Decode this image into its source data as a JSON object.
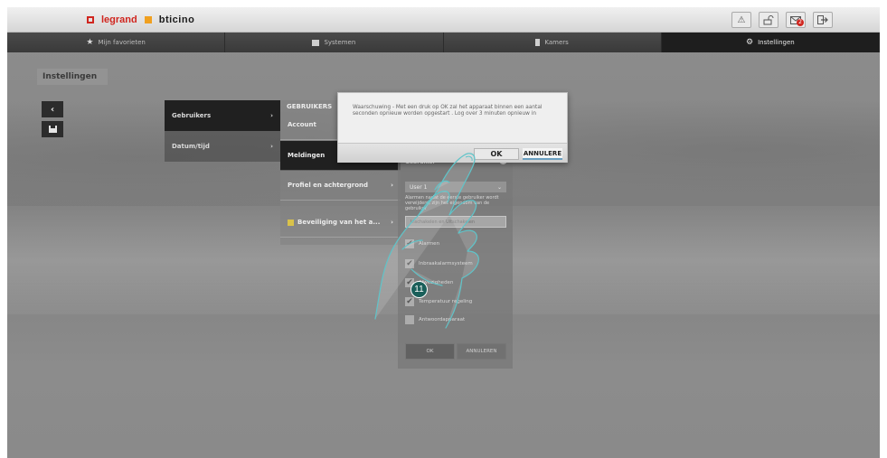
{
  "brand": {
    "legrand": "legrand",
    "bticino": "bticino"
  },
  "topbar": {
    "msg_count": "2"
  },
  "nav": {
    "tabs": [
      {
        "label": "Mijn favorieten"
      },
      {
        "label": "Systemen"
      },
      {
        "label": "Kamers"
      },
      {
        "label": "Instellingen"
      }
    ]
  },
  "page": {
    "title": "Instellingen",
    "back": "‹"
  },
  "menu": {
    "items": [
      {
        "label": "Gebruikers",
        "chev": "›"
      },
      {
        "label": "Datum/tijd",
        "chev": "›"
      }
    ]
  },
  "submenu": {
    "header": "GEBRUIKERS",
    "items": [
      {
        "label": "Account",
        "chev": ""
      },
      {
        "label": "Meldingen",
        "chev": ""
      },
      {
        "label": "Profiel en achtergrond",
        "chev": "›"
      },
      {
        "label": "Beveiliging van het a...",
        "chev": "›"
      }
    ]
  },
  "form": {
    "label": "Gebruiker",
    "info": "i",
    "select_value": "User 1",
    "select_arrow": "⌄",
    "description": "Alarmen nadat de eerste gebruiker wordt verwijderd, zijn het eigendom van de gebruiker",
    "input_placeholder": "Inschakelen en Uitschakelen",
    "checkboxes": [
      {
        "label": "Alarmen",
        "check": "✔"
      },
      {
        "label": "Inbraakalarmsysteem",
        "check": "✔"
      },
      {
        "label": "Afwezigheden",
        "check": "✔"
      },
      {
        "label": "Temperatuur regeling",
        "check": "✔"
      },
      {
        "label": "Antwoordapparaat",
        "check": ""
      }
    ],
    "ok": "OK",
    "cancel": "ANNULEREN"
  },
  "dialog": {
    "message": "Waarschuwing - Met een druk op OK zal het apparaat binnen een aantal seconden opnieuw worden opgestart . Log over 3 minuten opnieuw in",
    "ok": "OK",
    "cancel": "ANNULERE"
  },
  "step": "11"
}
